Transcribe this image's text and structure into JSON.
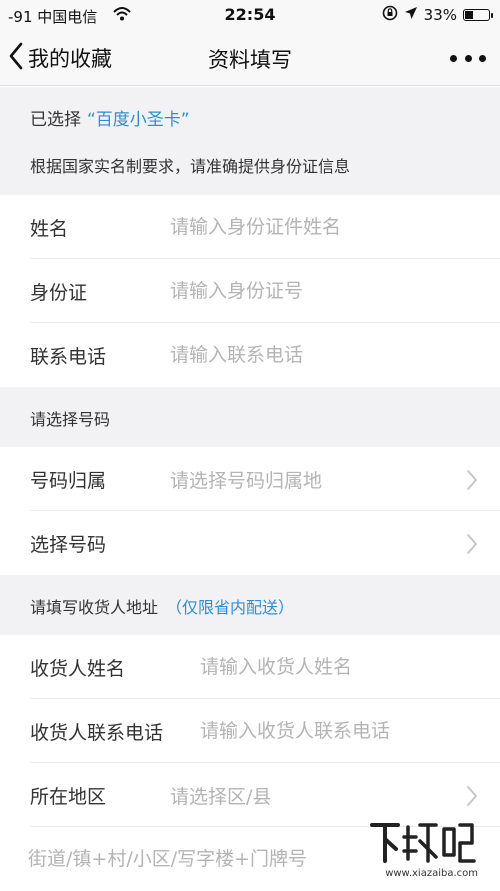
{
  "status_bar": {
    "carrier": "-91 中国电信",
    "time": "22:54",
    "battery": "33%"
  },
  "nav": {
    "back_label": "我的收藏",
    "title": "资料填写"
  },
  "selection": {
    "prefix": "已选择",
    "card_name": "“百度小圣卡”"
  },
  "id_notice": "根据国家实名制要求，请准确提供身份证信息",
  "identity_fields": [
    {
      "label": "姓名",
      "placeholder": "请输入身份证件姓名"
    },
    {
      "label": "身份证",
      "placeholder": "请输入身份证号"
    },
    {
      "label": "联系电话",
      "placeholder": "请输入联系电话"
    }
  ],
  "number_section": {
    "title": "请选择号码",
    "rows": [
      {
        "label": "号码归属",
        "placeholder": "请选择号码归属地"
      },
      {
        "label": "选择号码",
        "placeholder": ""
      }
    ]
  },
  "address_section": {
    "title": "请填写收货人地址",
    "note": "（仅限省内配送）",
    "fields": [
      {
        "label": "收货人姓名",
        "placeholder": "请输入收货人姓名"
      },
      {
        "label": "收货人联系电话",
        "placeholder": "请输入收货人联系电话"
      }
    ],
    "region": {
      "label": "所在地区",
      "placeholder": "请选择区/县"
    },
    "street_placeholder": "街道/镇+村/小区/写字楼+门牌号"
  },
  "watermark": {
    "text": "下载吧",
    "site": "www.xiazaiba.com"
  },
  "colors": {
    "accent": "#2b8fd6",
    "placeholder": "#b4b4b4",
    "background": "#f2f2f4"
  }
}
